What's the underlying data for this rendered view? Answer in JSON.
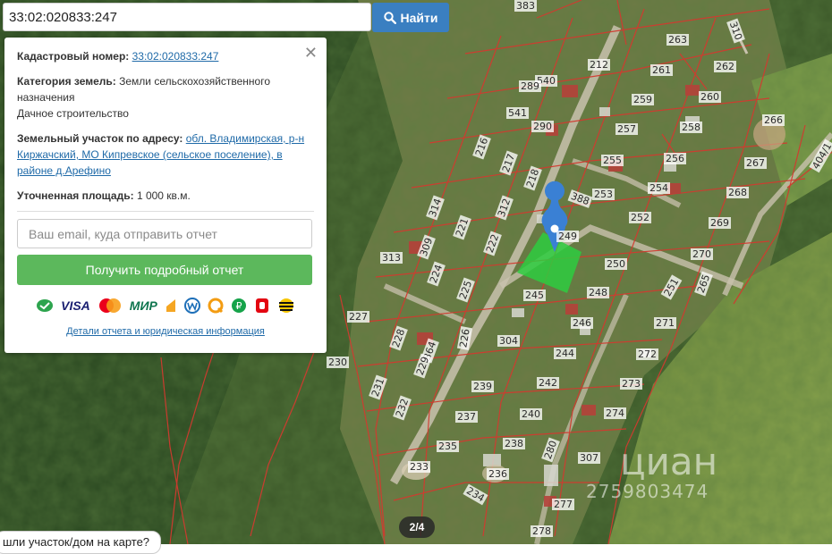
{
  "search": {
    "value": "33:02:020833:247",
    "button_label": "Найти"
  },
  "panel": {
    "cadastral_label": "Кадастровый номер:",
    "cadastral_value": "33:02:020833:247",
    "category_label": "Категория земель:",
    "category_value": "Земли сельскохозяйственного назначения",
    "use_value": "Дачное строительство",
    "address_label": "Земельный участок по адресу:",
    "address_value": "обл. Владимирская, р-н Киржачский, МО Кипревское (сельское поселение), в районе д.Арефино",
    "area_label": "Уточненная площадь:",
    "area_value": "1 000 кв.м.",
    "email_placeholder": "Ваш email, куда отправить отчет",
    "report_button": "Получить подробный отчет",
    "payments": [
      "VISA",
      "МИР"
    ],
    "details_link": "Детали отчета и юридическая информация"
  },
  "map": {
    "parcel_labels": [
      "383",
      "310",
      "263",
      "212",
      "540",
      "261",
      "262",
      "289",
      "260",
      "541",
      "259",
      "290",
      "257",
      "258",
      "266",
      "216",
      "217",
      "218",
      "255",
      "256",
      "267",
      "388",
      "253",
      "254",
      "268",
      "314",
      "312",
      "252",
      "269",
      "221",
      "222",
      "249",
      "250",
      "270",
      "313",
      "309",
      "224",
      "225",
      "248",
      "251",
      "245",
      "265",
      "227",
      "246",
      "271",
      "226",
      "228",
      "304",
      "364",
      "244",
      "272",
      "230",
      "229",
      "231",
      "239",
      "242",
      "273",
      "232",
      "237",
      "240",
      "274",
      "235",
      "238",
      "307",
      "233",
      "280",
      "236",
      "234",
      "277",
      "278",
      "404/1"
    ]
  },
  "gallery": {
    "counter": "2/4"
  },
  "prompt": {
    "question": "шли участок/дом на карте?"
  },
  "watermark": {
    "brand": "циан",
    "id": "2759803474"
  },
  "colors": {
    "button_blue": "#3a7fc1",
    "button_green": "#5cb85c",
    "parcel_line": "#c0392b",
    "selected_parcel": "#2ecc40"
  }
}
